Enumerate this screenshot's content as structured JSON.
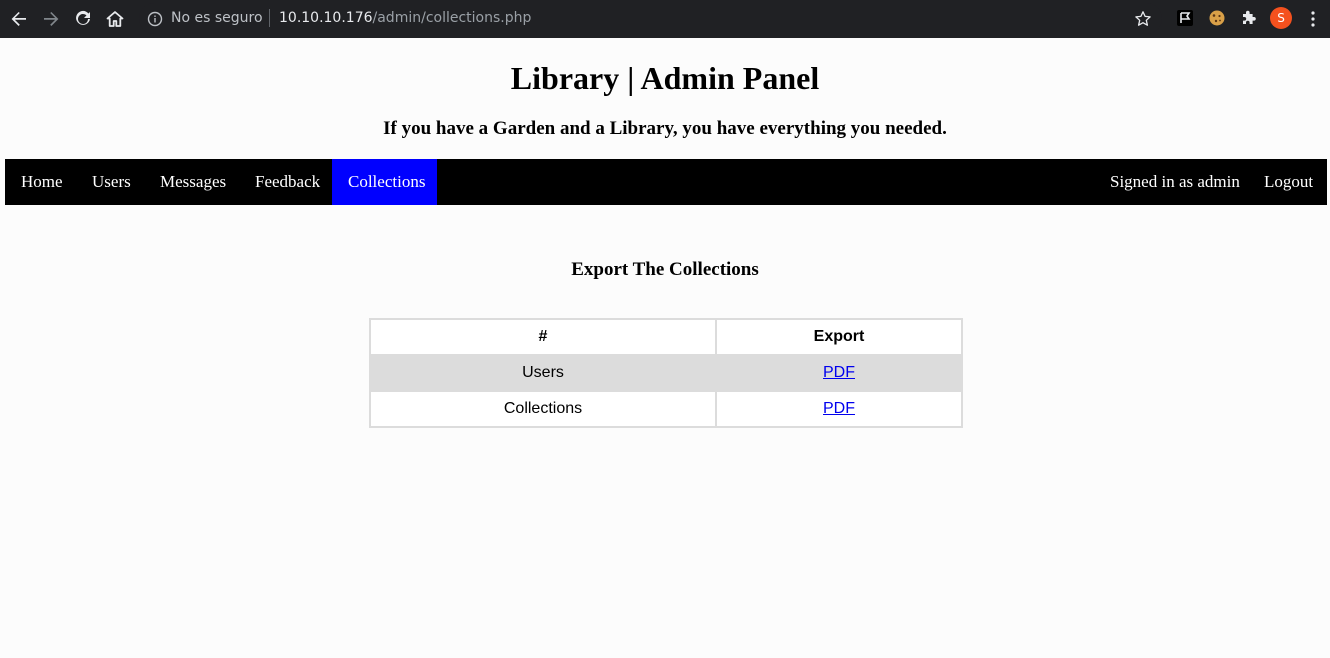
{
  "browser": {
    "security_label": "No es seguro",
    "url_host": "10.10.10.176",
    "url_path": "/admin/collections.php",
    "avatar_letter": "S"
  },
  "header": {
    "title": "Library | Admin Panel",
    "subtitle": "If you have a Garden and a Library, you have everything you needed."
  },
  "nav": {
    "items": [
      {
        "label": "Home"
      },
      {
        "label": "Users"
      },
      {
        "label": "Messages"
      },
      {
        "label": "Feedback"
      },
      {
        "label": "Collections",
        "active": true
      }
    ],
    "signed_in": "Signed in as admin",
    "logout": "Logout",
    "active_color": "#0000ff"
  },
  "main": {
    "heading": "Export The Collections",
    "table": {
      "headers": [
        "#",
        "Export"
      ],
      "rows": [
        {
          "name": "Users",
          "export": "PDF"
        },
        {
          "name": "Collections",
          "export": "PDF"
        }
      ]
    }
  }
}
